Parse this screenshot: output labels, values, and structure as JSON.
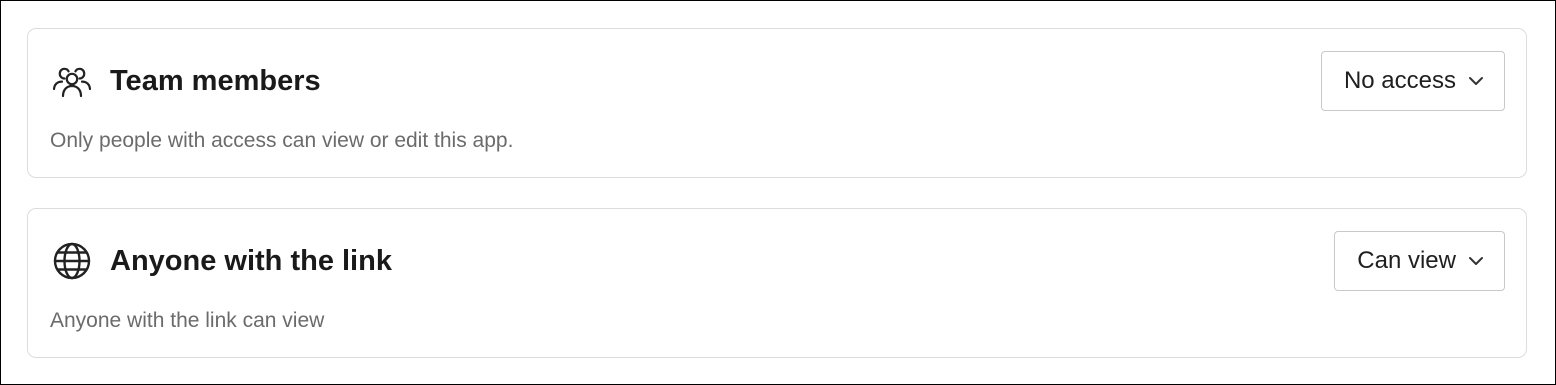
{
  "sections": [
    {
      "icon": "team-members-icon",
      "title": "Team members",
      "description": "Only people with access can view or edit this app.",
      "dropdown_value": "No access"
    },
    {
      "icon": "globe-icon",
      "title": "Anyone with the link",
      "description": "Anyone with the link can view",
      "dropdown_value": "Can view"
    }
  ],
  "colors": {
    "title_text": "#1a1a1a",
    "description_text": "#6b6b6b",
    "card_border": "#dcdcdc",
    "dropdown_border": "#c9c9c9"
  }
}
